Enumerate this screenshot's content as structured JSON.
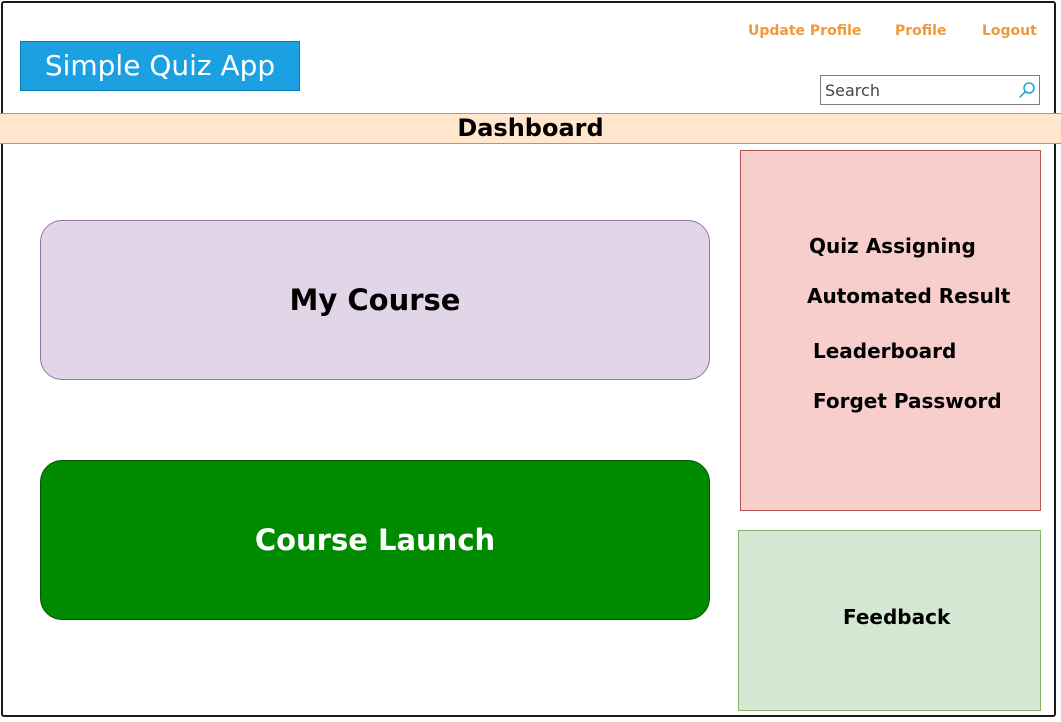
{
  "header": {
    "app_title": "Simple Quiz App",
    "nav": {
      "update_profile": "Update Profile",
      "profile": "Profile",
      "logout": "Logout"
    },
    "search": {
      "placeholder": "Search",
      "value": ""
    }
  },
  "page_title": "Dashboard",
  "tiles": {
    "my_course": "My Course",
    "course_launch": "Course Launch"
  },
  "features": [
    "Quiz Assigning",
    "Automated Result",
    "Leaderboard",
    "Forget Password"
  ],
  "feedback": "Feedback",
  "icons": {
    "search": "search-icon"
  },
  "colors": {
    "logo_bg": "#1ba1e2",
    "nav_link": "#f0993a",
    "dashboard_bar": "#ffe6cc",
    "my_course_tile": "#e1d5e7",
    "course_launch_tile": "#008a00",
    "features_panel": "#f8cecc",
    "feedback_panel": "#d5e8d4"
  }
}
